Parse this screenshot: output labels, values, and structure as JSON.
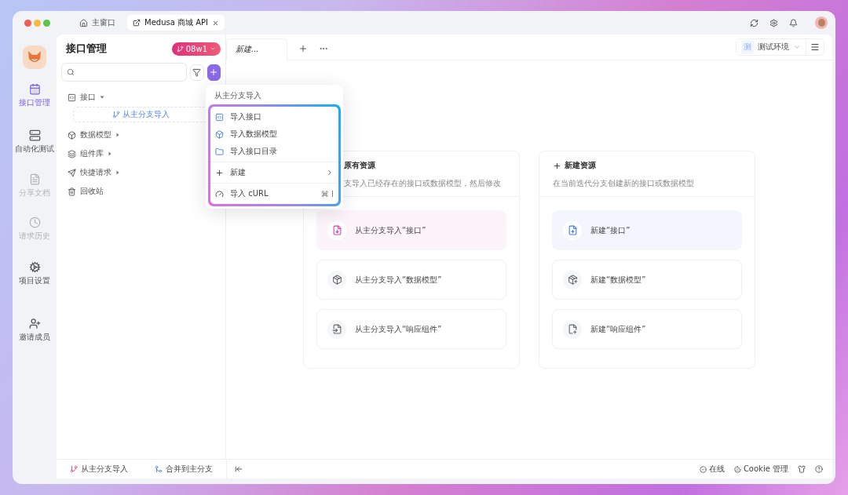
{
  "window": {
    "tabs": [
      {
        "label": "主窗口",
        "selected": false
      },
      {
        "label": "Medusa 商城 API",
        "selected": true
      }
    ]
  },
  "rail": [
    {
      "label": "接口管理",
      "selected": true,
      "disabled": false
    },
    {
      "label": "自动化测试",
      "selected": false,
      "disabled": false
    },
    {
      "label": "分享文档",
      "selected": false,
      "disabled": true
    },
    {
      "label": "请求历史",
      "selected": false,
      "disabled": true
    },
    {
      "label": "项目设置",
      "selected": false,
      "disabled": false
    },
    {
      "label": "邀请成员",
      "selected": false,
      "disabled": false
    }
  ],
  "panel": {
    "title": "接口管理",
    "branch": "08w1",
    "tree": [
      {
        "label": "接口",
        "expanded": true,
        "children": [
          {
            "label": "从主分支导入"
          }
        ]
      },
      {
        "label": "数据模型",
        "expanded": false
      },
      {
        "label": "组件库",
        "expanded": false
      },
      {
        "label": "快捷请求",
        "expanded": false
      },
      {
        "label": "回收站"
      }
    ]
  },
  "menu": {
    "heading": "从主分支导入",
    "groups": [
      [
        {
          "label": "导入接口",
          "kind": "item"
        },
        {
          "label": "导入数据模型",
          "kind": "item"
        },
        {
          "label": "导入接口目录",
          "kind": "item"
        }
      ],
      [
        {
          "label": "新建",
          "kind": "submenu"
        }
      ],
      [
        {
          "label": "导入 cURL",
          "kind": "item",
          "shortcut": "⌘ I"
        }
      ]
    ]
  },
  "editor_tabs": [
    {
      "label": "新建...",
      "selected": true
    }
  ],
  "environment": {
    "badge": "测",
    "label": "测试环境"
  },
  "cards": [
    {
      "kind": "import",
      "title": "原有资源",
      "description": "支导入已经存在的接口或数据模型，然后修改",
      "actions": [
        {
          "label": "从主分支导入“接口”",
          "highlighted": true
        },
        {
          "label": "从主分支导入“数据模型”",
          "highlighted": false
        },
        {
          "label": "从主分支导入“响应组件”",
          "highlighted": false
        }
      ]
    },
    {
      "kind": "create",
      "title": "新建资源",
      "description": "在当前迭代分支创建新的接口或数据模型",
      "actions": [
        {
          "label": "新建“接口”",
          "highlighted": true
        },
        {
          "label": "新建“数据模型”",
          "highlighted": false
        },
        {
          "label": "新建“响应组件”",
          "highlighted": false
        }
      ]
    }
  ],
  "footer": {
    "actions": [
      {
        "label": "从主分支导入",
        "kind": "import"
      },
      {
        "label": "合并到主分支",
        "kind": "merge"
      }
    ],
    "status": [
      {
        "label": "在线",
        "kind": "online"
      },
      {
        "label": "Cookie 管理",
        "kind": "cookie"
      }
    ]
  }
}
